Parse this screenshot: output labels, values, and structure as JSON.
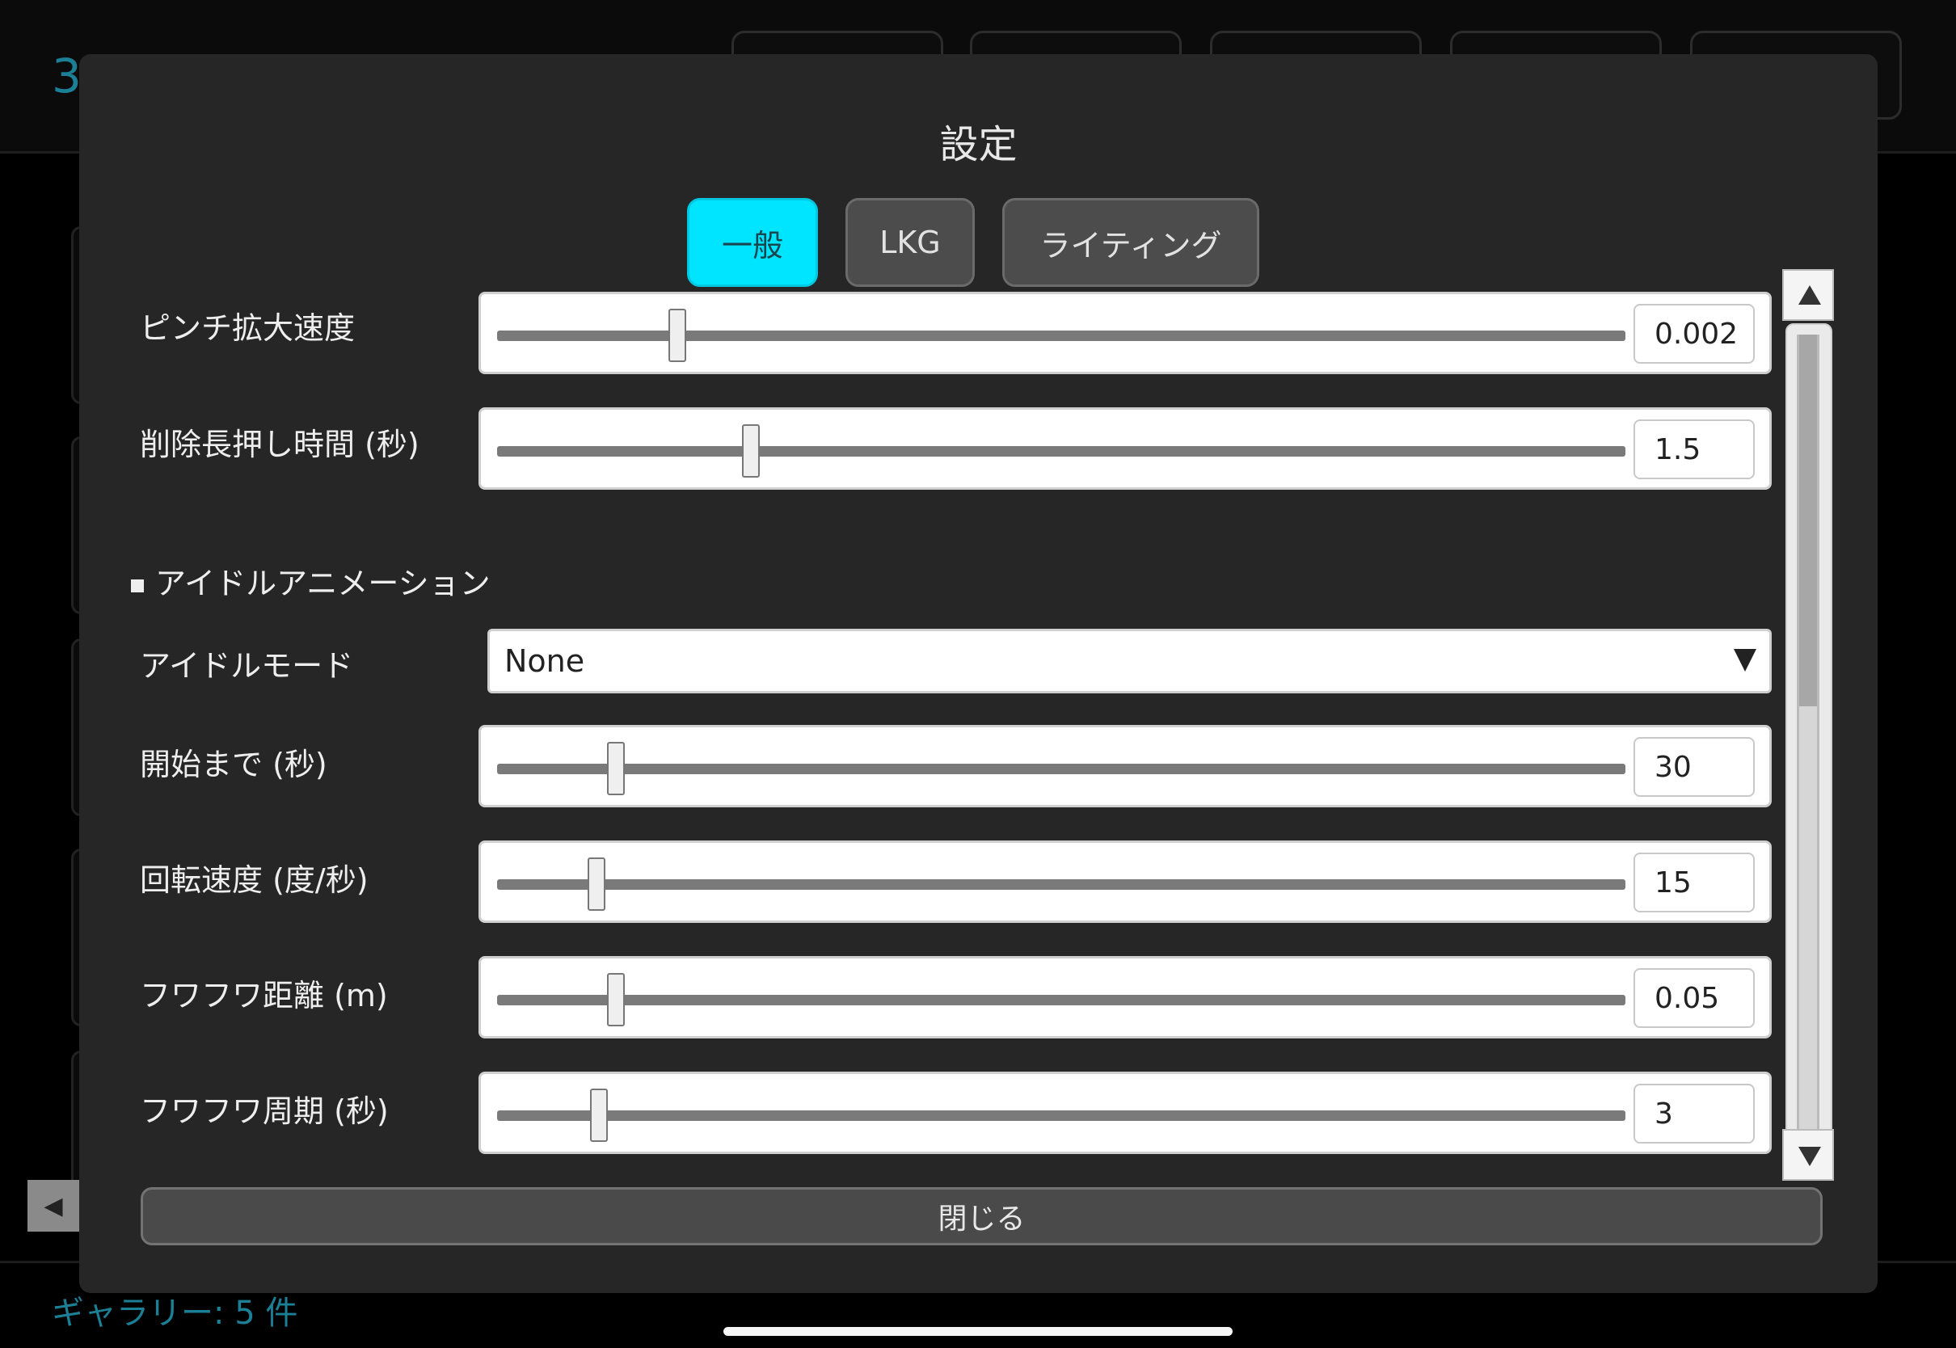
{
  "background": {
    "title": "3",
    "gallery_label": "ギャラリー: 5 件",
    "prev_icon": "◀"
  },
  "modal": {
    "title": "設定",
    "tabs": [
      {
        "label": "一般",
        "active": true
      },
      {
        "label": "LKG",
        "active": false
      },
      {
        "label": "ライティング",
        "active": false
      }
    ],
    "settings": [
      {
        "label": "ピンチ拡大速度",
        "value": "0.002",
        "slider_fraction": 0.16
      },
      {
        "label": "削除長押し時間 (秒)",
        "value": "1.5",
        "slider_fraction": 0.225
      }
    ],
    "idle_section": {
      "heading": "アイドルアニメーション",
      "mode_label": "アイドルモード",
      "mode_value": "None",
      "settings": [
        {
          "label": "開始まで (秒)",
          "value": "30",
          "slider_fraction": 0.105
        },
        {
          "label": "回転速度 (度/秒)",
          "value": "15",
          "slider_fraction": 0.088
        },
        {
          "label": "フワフワ距離 (m)",
          "value": "0.05",
          "slider_fraction": 0.105
        },
        {
          "label": "フワフワ周期 (秒)",
          "value": "3",
          "slider_fraction": 0.09
        }
      ]
    },
    "close_label": "閉じる"
  },
  "colors": {
    "accent": "#00e5ff",
    "modal_bg": "#262626",
    "bg_text": "#1b7f95"
  },
  "icons": {
    "scroll_up": "triangle-up-icon",
    "scroll_down": "triangle-down-icon",
    "dropdown": "triangle-down-icon"
  }
}
